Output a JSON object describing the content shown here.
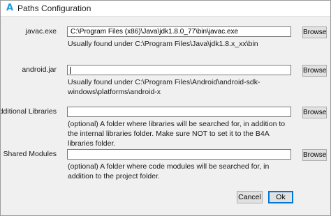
{
  "window": {
    "title": "Paths Configuration",
    "app_icon_glyph": "A",
    "app_icon_color": "#1e9be0"
  },
  "fields": [
    {
      "label": "javac.exe",
      "value": "C:\\Program Files (x86)\\Java\\jdk1.8.0_77\\bin\\javac.exe",
      "hint": "Usually found under C:\\Program Files\\Java\\jdk1.8.x_xx\\bin",
      "browse_label": "Browse"
    },
    {
      "label": "android.jar",
      "value": "",
      "hint": "Usually found under C:\\Program Files\\Android\\android-sdk-windows\\platforms\\android-x",
      "browse_label": "Browse"
    },
    {
      "label": "Additional Libraries",
      "value": "",
      "hint": "(optional) A folder where libraries will be searched for, in addition to the internal libraries folder. Make sure NOT to set it to the B4A libraries folder.",
      "browse_label": "Browse"
    },
    {
      "label": "Shared Modules",
      "value": "",
      "hint": "(optional) A folder where code modules will be searched for, in addition to the project folder.",
      "browse_label": "Browse"
    }
  ],
  "buttons": {
    "cancel_label": "Cancel",
    "ok_label": "Ok"
  }
}
